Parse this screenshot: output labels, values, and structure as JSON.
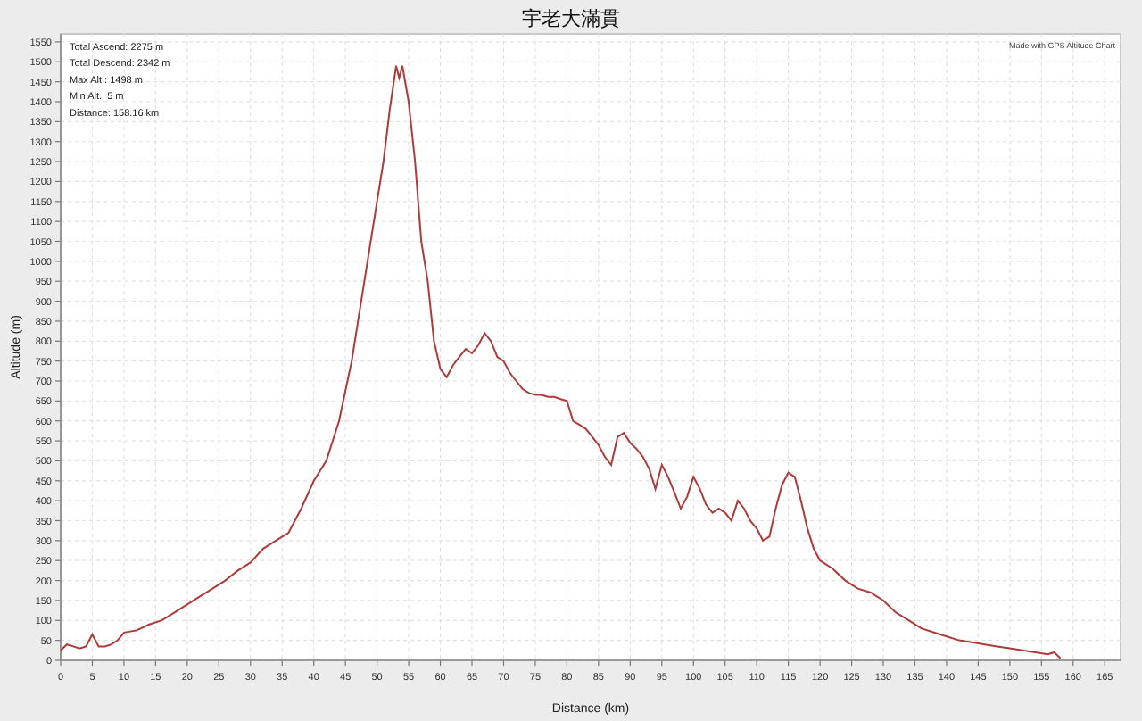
{
  "chart": {
    "stats": [
      "Total Ascend: 2275 m",
      "Total Descend: 2342 m",
      "Max Alt.: 1498 m",
      "Min Alt.: 5 m",
      "Distance: 158.16 km"
    ],
    "credit": "Made with GPS Altitude Chart",
    "chart_data": {
      "type": "line",
      "title": "宇老大滿貫",
      "xlabel": "Distance (km)",
      "ylabel": "Altitude (m)",
      "grid": true,
      "xlim": [
        0,
        167.5
      ],
      "ylim": [
        0,
        1570
      ],
      "xticks": [
        0,
        5,
        10,
        15,
        20,
        25,
        30,
        35,
        40,
        45,
        50,
        55,
        60,
        65,
        70,
        75,
        80,
        85,
        90,
        95,
        100,
        105,
        110,
        115,
        120,
        125,
        130,
        135,
        140,
        145,
        150,
        155,
        160,
        165
      ],
      "yticks": [
        0,
        50,
        100,
        150,
        200,
        250,
        300,
        350,
        400,
        450,
        500,
        550,
        600,
        650,
        700,
        750,
        800,
        850,
        900,
        950,
        1000,
        1050,
        1100,
        1150,
        1200,
        1250,
        1300,
        1350,
        1400,
        1450,
        1500,
        1550
      ],
      "x": [
        0,
        1,
        2,
        3,
        4,
        5,
        6,
        7,
        8,
        9,
        10,
        12,
        14,
        16,
        18,
        20,
        22,
        24,
        26,
        28,
        30,
        32,
        34,
        36,
        38,
        40,
        42,
        44,
        46,
        48,
        50,
        51,
        52,
        53,
        53.5,
        54,
        55,
        56,
        57,
        58,
        59,
        60,
        61,
        62,
        63,
        64,
        65,
        66,
        67,
        68,
        69,
        70,
        71,
        72,
        73,
        74,
        75,
        76,
        77,
        78,
        79,
        80,
        81,
        82,
        83,
        84,
        85,
        86,
        87,
        88,
        89,
        90,
        91,
        92,
        93,
        94,
        95,
        96,
        97,
        98,
        99,
        100,
        101,
        102,
        103,
        104,
        105,
        106,
        107,
        108,
        109,
        110,
        111,
        112,
        113,
        114,
        115,
        116,
        117,
        118,
        119,
        120,
        122,
        124,
        126,
        128,
        130,
        132,
        134,
        136,
        138,
        140,
        142,
        144,
        146,
        148,
        150,
        152,
        154,
        156,
        157,
        158
      ],
      "series": [
        {
          "color": "#b03a3a",
          "values": [
            25,
            40,
            35,
            30,
            35,
            65,
            35,
            35,
            40,
            50,
            70,
            75,
            90,
            100,
            120,
            140,
            160,
            180,
            200,
            225,
            245,
            280,
            300,
            320,
            380,
            450,
            500,
            600,
            750,
            950,
            1150,
            1250,
            1380,
            1490,
            1460,
            1490,
            1400,
            1250,
            1050,
            950,
            800,
            730,
            710,
            740,
            760,
            780,
            770,
            790,
            820,
            800,
            760,
            750,
            720,
            700,
            680,
            670,
            665,
            665,
            660,
            660,
            655,
            650,
            600,
            590,
            580,
            560,
            540,
            510,
            490,
            560,
            570,
            545,
            530,
            510,
            480,
            430,
            490,
            460,
            420,
            380,
            410,
            460,
            430,
            390,
            370,
            380,
            370,
            350,
            400,
            380,
            350,
            330,
            300,
            310,
            380,
            440,
            470,
            460,
            400,
            330,
            280,
            250,
            230,
            200,
            180,
            170,
            150,
            120,
            100,
            80,
            70,
            60,
            50,
            45,
            40,
            35,
            30,
            25,
            20,
            15,
            20,
            5
          ]
        }
      ]
    }
  }
}
